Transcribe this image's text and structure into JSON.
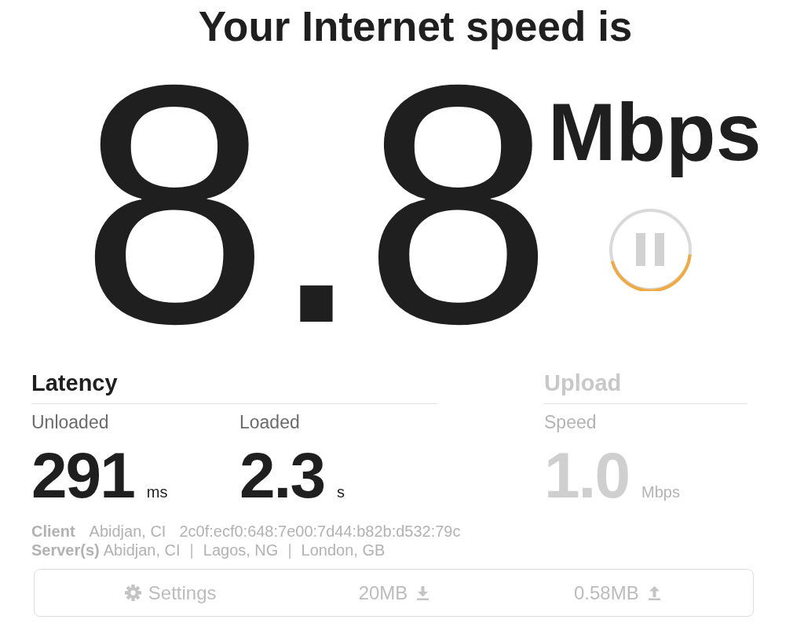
{
  "title": "Your Internet speed is",
  "speed": {
    "value": "8.8",
    "unit": "Mbps",
    "running": true
  },
  "latency": {
    "heading": "Latency",
    "pending": false,
    "metrics": [
      {
        "label": "Unloaded",
        "value": "291",
        "unit": "ms"
      },
      {
        "label": "Loaded",
        "value": "2.3",
        "unit": "s"
      }
    ]
  },
  "upload": {
    "heading": "Upload",
    "pending": true,
    "metrics": [
      {
        "label": "Speed",
        "value": "1.0",
        "unit": "Mbps"
      }
    ]
  },
  "client": {
    "label": "Client",
    "location": "Abidjan, CI",
    "address": "2c0f:ecf0:648:7e00:7d44:b82b:d532:79c"
  },
  "servers": {
    "label": "Server(s)",
    "items": [
      {
        "kind": "location",
        "text": "Abidjan, CI"
      },
      {
        "kind": "separator",
        "text": "|"
      },
      {
        "kind": "location",
        "text": "Lagos, NG"
      },
      {
        "kind": "separator",
        "text": "|"
      },
      {
        "kind": "location",
        "text": "London, GB"
      }
    ]
  },
  "footer": {
    "items": [
      {
        "kind": "settings",
        "label": "Settings"
      },
      {
        "kind": "download",
        "label": "20MB"
      },
      {
        "kind": "upload",
        "label": "0.58MB"
      }
    ]
  }
}
